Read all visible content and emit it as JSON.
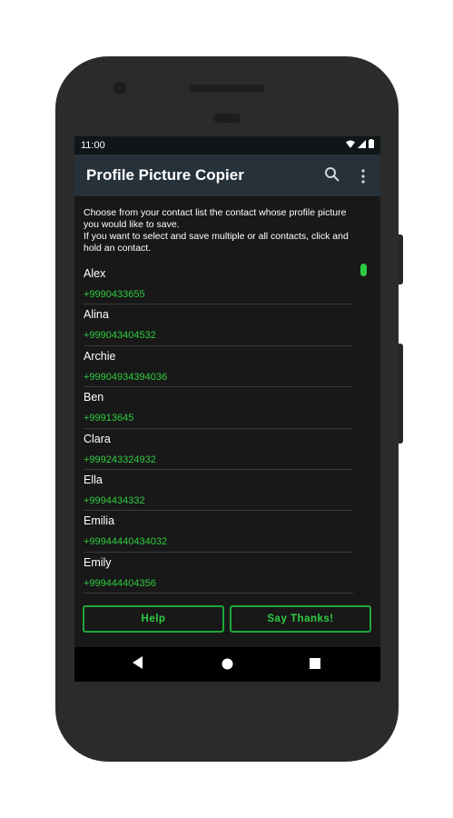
{
  "status_bar": {
    "time": "11:00"
  },
  "app_bar": {
    "title": "Profile Picture Copier",
    "icons": [
      "search-icon",
      "more-vert-icon"
    ]
  },
  "intro": {
    "line1": "Choose from your contact list the contact whose profile picture you would like to save.",
    "line2": "If you want to select and save multiple or all contacts, click and hold an contact."
  },
  "contacts": [
    {
      "name": "Alex",
      "phone": "+9990433655"
    },
    {
      "name": "Alina",
      "phone": "+999043404532"
    },
    {
      "name": "Archie",
      "phone": "+99904934394036"
    },
    {
      "name": "Ben",
      "phone": "+99913645"
    },
    {
      "name": "Clara",
      "phone": "+999243324932"
    },
    {
      "name": "Ella",
      "phone": "+9994434332"
    },
    {
      "name": "Emilia",
      "phone": "+999444404340​32"
    },
    {
      "name": "Emily",
      "phone": "+999444404356"
    }
  ],
  "buttons": {
    "help": "Help",
    "thanks": "Say Thanks!"
  },
  "colors": {
    "accent": "#2ecc40",
    "appbar": "#27313a",
    "background": "#181818"
  }
}
